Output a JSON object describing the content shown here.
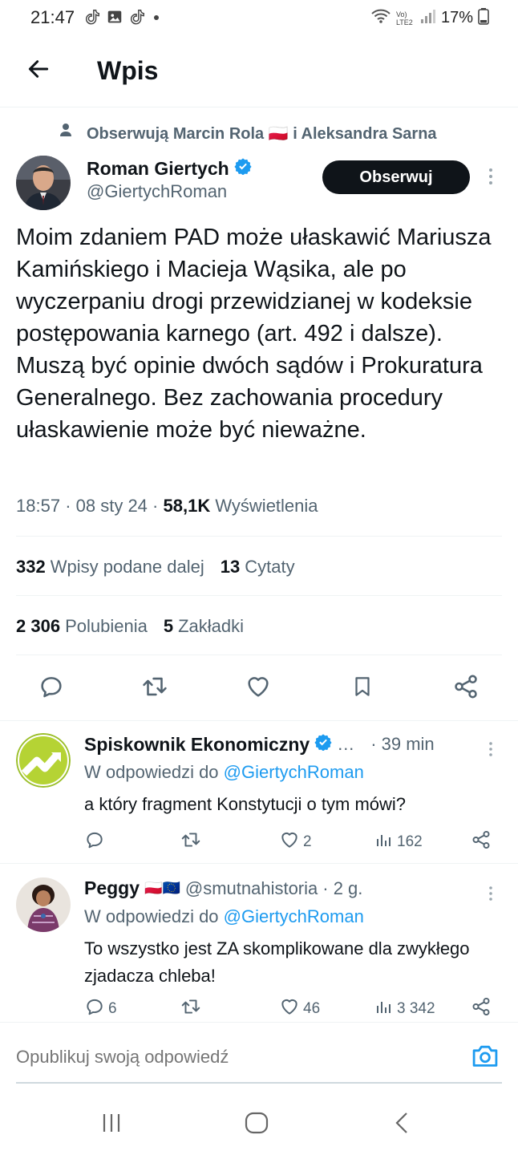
{
  "status_bar": {
    "time": "21:47",
    "lte_label": "Vo) LTE2",
    "battery": "17%"
  },
  "header": {
    "title": "Wpis"
  },
  "social_context": {
    "text": "Obserwują Marcin Rola 🇵🇱 i Aleksandra Sarna"
  },
  "tweet": {
    "author_name": "Roman Giertych",
    "author_handle": "@GiertychRoman",
    "follow_label": "Obserwuj",
    "text": "Moim zdaniem PAD może ułaskawić Mariusza Kamińskiego i Macieja Wąsika, ale po wyczerpaniu drogi przewidzianej w kodeksie postępowania karnego (art. 492 i dalsze). Muszą być opinie dwóch sądów i Prokuratura Generalnego. Bez zachowania procedury ułaskawienie może być nieważne.",
    "time": "18:57",
    "date": "08 sty 24",
    "views_count": "58,1K",
    "views_label": "Wyświetlenia",
    "retweets_count": "332",
    "retweets_label": "Wpisy podane dalej",
    "quotes_count": "13",
    "quotes_label": "Cytaty",
    "likes_count": "2 306",
    "likes_label": "Polubienia",
    "bookmarks_count": "5",
    "bookmarks_label": "Zakładki"
  },
  "replies": [
    {
      "name": "Spiskownik Ekonomiczny",
      "name_suffix": "…",
      "time": "· 39 min",
      "in_reply_prefix": "W odpowiedzi do",
      "in_reply_handle": "@GiertychRoman",
      "text": "a który fragment Konstytucji o tym mówi?",
      "replies": "",
      "retweets": "",
      "likes": "2",
      "views": "162"
    },
    {
      "name": "Peggy",
      "flags": "🇵🇱🇪🇺",
      "handle": "@smutnahistoria",
      "time": "· 2 g.",
      "in_reply_prefix": "W odpowiedzi do",
      "in_reply_handle": "@GiertychRoman",
      "text": "To wszystko jest ZA skomplikowane dla zwykłego zjadacza chleba!",
      "replies": "6",
      "retweets": "",
      "likes": "46",
      "views": "3 342"
    }
  ],
  "composer": {
    "placeholder": "Opublikuj swoją odpowiedź"
  },
  "colors": {
    "accent": "#1d9bf0",
    "text_primary": "#0f1419",
    "text_secondary": "#536471",
    "divider": "#eff3f4",
    "verified": "#1d9bf0",
    "follow_bg": "#0f1419",
    "spiskownik_logo": "#b5d334"
  },
  "icons": {
    "back": "arrow-left-icon",
    "more": "more-vertical-icon",
    "reply": "reply-icon",
    "retweet": "retweet-icon",
    "like": "heart-icon",
    "bookmark": "bookmark-icon",
    "share": "share-icon",
    "views": "views-icon",
    "camera": "camera-icon",
    "verified": "verified-badge-icon"
  }
}
